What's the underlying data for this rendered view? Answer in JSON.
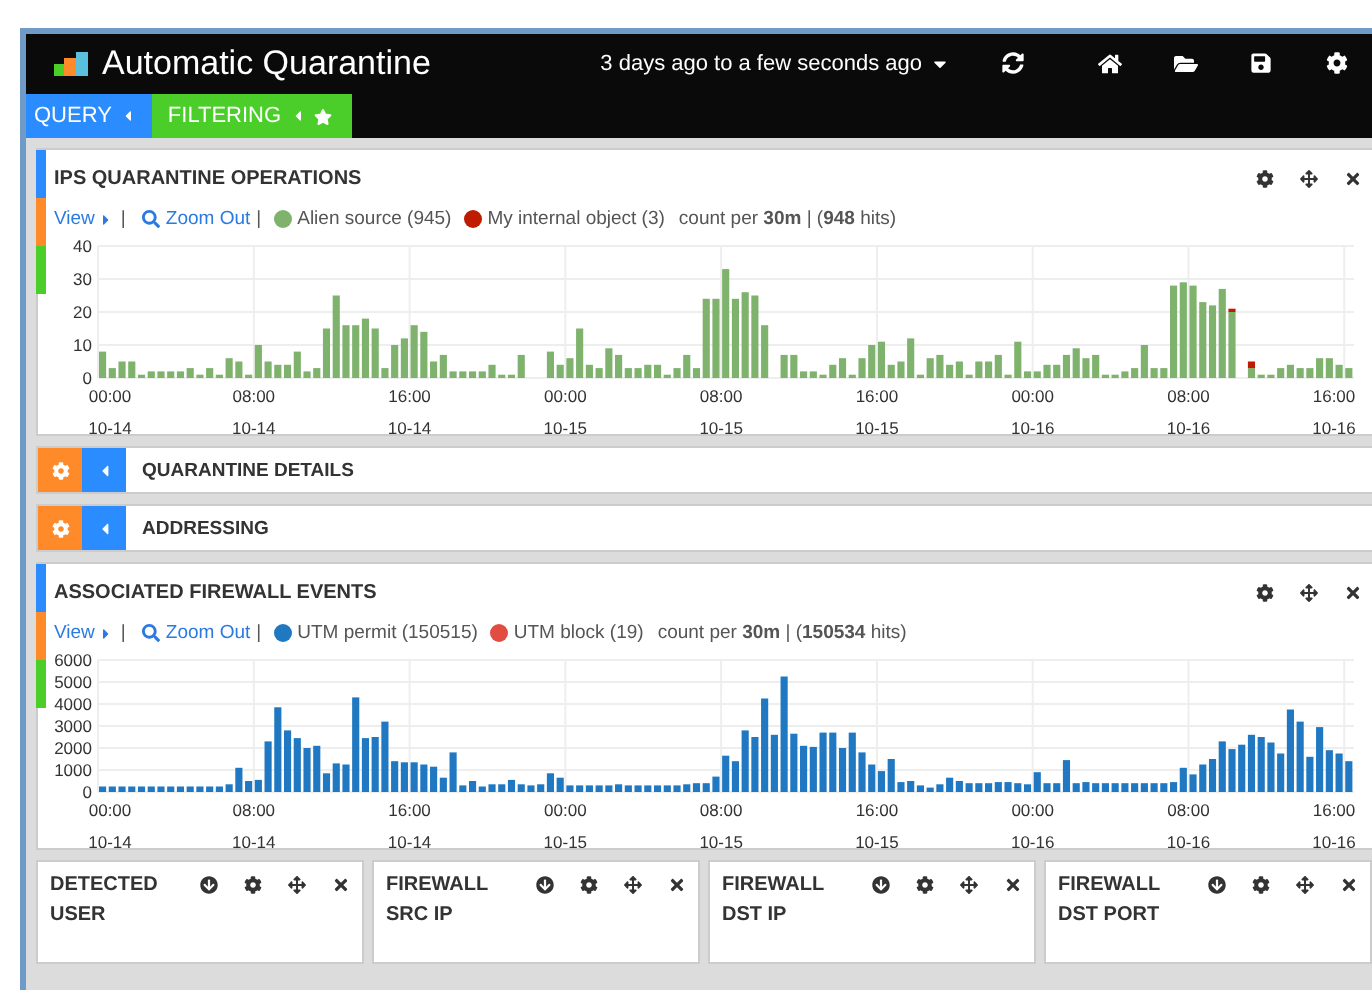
{
  "header": {
    "title": "Automatic Quarantine",
    "time_range": "3 days ago to a few seconds ago"
  },
  "tabs": [
    {
      "label": "QUERY",
      "kind": "query"
    },
    {
      "label": "FILTERING",
      "kind": "filtering"
    }
  ],
  "panels": [
    {
      "title": "IPS QUARANTINE OPERATIONS",
      "view": "View",
      "zoom": "Zoom Out",
      "legend": [
        {
          "label": "Alien source (945)",
          "color": "#7eb26d"
        },
        {
          "label": "My internal object (3)",
          "color": "#bf1b00"
        }
      ],
      "summary": "count per **30m** | (**948** hits)",
      "separator": "|",
      "x_labels": [
        {
          "time": "00:00",
          "date": "10-14"
        },
        {
          "time": "08:00",
          "date": "10-14"
        },
        {
          "time": "16:00",
          "date": "10-14"
        },
        {
          "time": "00:00",
          "date": "10-15"
        },
        {
          "time": "08:00",
          "date": "10-15"
        },
        {
          "time": "16:00",
          "date": "10-15"
        },
        {
          "time": "00:00",
          "date": "10-16"
        },
        {
          "time": "08:00",
          "date": "10-16"
        },
        {
          "time": "16:00",
          "date": "10-16"
        }
      ],
      "chart_data": {
        "type": "bar",
        "stacked": true,
        "grid": true,
        "ylim": [
          0,
          40
        ],
        "yticks": [
          0,
          10,
          20,
          30,
          40
        ],
        "series": [
          {
            "color": "#7eb26d",
            "values": [
              8,
              3,
              5,
              5,
              1,
              2,
              2,
              2,
              2,
              3,
              1,
              3,
              1,
              6,
              5,
              1,
              10,
              5,
              4,
              4,
              8,
              2,
              3,
              15,
              25,
              16,
              16,
              18,
              15,
              3,
              10,
              12,
              16,
              14,
              5,
              7,
              2,
              2,
              2,
              2,
              4,
              1,
              1,
              7,
              0,
              0,
              8,
              4,
              6,
              15,
              4,
              3,
              9,
              7,
              3,
              3,
              4,
              4,
              1,
              3,
              7,
              3,
              24,
              24,
              33,
              24,
              26,
              25,
              16,
              0,
              7,
              7,
              2,
              2,
              1,
              4,
              6,
              1,
              6,
              10,
              11,
              4,
              5,
              12,
              1,
              6,
              7,
              4,
              5,
              1,
              5,
              5,
              7,
              1,
              11,
              2,
              2,
              4,
              4,
              7,
              9,
              6,
              7,
              1,
              1,
              2,
              3,
              10,
              3,
              3,
              28,
              29,
              28,
              23,
              22,
              27,
              20,
              0,
              3,
              1,
              1,
              3,
              4,
              3,
              3,
              6,
              6,
              4,
              3
            ]
          },
          {
            "color": "#bf1b00",
            "values": [
              0,
              0,
              0,
              0,
              0,
              0,
              0,
              0,
              0,
              0,
              0,
              0,
              0,
              0,
              0,
              0,
              0,
              0,
              0,
              0,
              0,
              0,
              0,
              0,
              0,
              0,
              0,
              0,
              0,
              0,
              0,
              0,
              0,
              0,
              0,
              0,
              0,
              0,
              0,
              0,
              0,
              0,
              0,
              0,
              0,
              0,
              0,
              0,
              0,
              0,
              0,
              0,
              0,
              0,
              0,
              0,
              0,
              0,
              0,
              0,
              0,
              0,
              0,
              0,
              0,
              0,
              0,
              0,
              0,
              0,
              0,
              0,
              0,
              0,
              0,
              0,
              0,
              0,
              0,
              0,
              0,
              0,
              0,
              0,
              0,
              0,
              0,
              0,
              0,
              0,
              0,
              0,
              0,
              0,
              0,
              0,
              0,
              0,
              0,
              0,
              0,
              0,
              0,
              0,
              0,
              0,
              0,
              0,
              0,
              0,
              0,
              0,
              0,
              0,
              0,
              0,
              1,
              0,
              2,
              0,
              0,
              0,
              0,
              0,
              0,
              0,
              0,
              0,
              0
            ]
          }
        ]
      }
    },
    {
      "title": "ASSOCIATED FIREWALL EVENTS",
      "view": "View",
      "zoom": "Zoom Out",
      "legend": [
        {
          "label": "UTM permit (150515)",
          "color": "#1f78c1"
        },
        {
          "label": "UTM block (19)",
          "color": "#e24d42"
        }
      ],
      "summary": "count per **30m** | (**150534** hits)",
      "separator": "|",
      "x_labels": [
        {
          "time": "00:00",
          "date": "10-14"
        },
        {
          "time": "08:00",
          "date": "10-14"
        },
        {
          "time": "16:00",
          "date": "10-14"
        },
        {
          "time": "00:00",
          "date": "10-15"
        },
        {
          "time": "08:00",
          "date": "10-15"
        },
        {
          "time": "16:00",
          "date": "10-15"
        },
        {
          "time": "00:00",
          "date": "10-16"
        },
        {
          "time": "08:00",
          "date": "10-16"
        },
        {
          "time": "16:00",
          "date": "10-16"
        }
      ],
      "chart_data": {
        "type": "bar",
        "stacked": true,
        "grid": true,
        "ylim": [
          0,
          6000
        ],
        "yticks": [
          0,
          1000,
          2000,
          3000,
          4000,
          5000,
          6000
        ],
        "series": [
          {
            "color": "#1f78c1",
            "values": [
              250,
              250,
              250,
              250,
              250,
              250,
              250,
              250,
              250,
              250,
              250,
              250,
              250,
              350,
              1100,
              500,
              550,
              2300,
              3850,
              2800,
              2450,
              2000,
              2100,
              850,
              1300,
              1250,
              4300,
              2450,
              2500,
              3200,
              1400,
              1350,
              1350,
              1250,
              1150,
              650,
              1800,
              300,
              500,
              250,
              350,
              350,
              550,
              350,
              300,
              350,
              850,
              650,
              300,
              300,
              300,
              300,
              300,
              350,
              300,
              300,
              300,
              300,
              300,
              300,
              350,
              400,
              400,
              700,
              1650,
              1400,
              2800,
              2500,
              4250,
              2600,
              5250,
              2650,
              2100,
              2050,
              2700,
              2700,
              2000,
              2700,
              1800,
              1250,
              950,
              1500,
              450,
              500,
              300,
              200,
              350,
              650,
              500,
              400,
              400,
              400,
              450,
              450,
              400,
              350,
              900,
              400,
              400,
              1450,
              400,
              450,
              400,
              400,
              400,
              400,
              400,
              400,
              400,
              400,
              450,
              1100,
              800,
              1250,
              1500,
              2300,
              1950,
              2150,
              2600,
              2500,
              2250,
              1750,
              3750,
              3200,
              1600,
              2950,
              1900,
              1750,
              1400
            ]
          }
        ]
      }
    }
  ],
  "collapsed": [
    {
      "title": "QUARANTINE DETAILS"
    },
    {
      "title": "ADDRESSING"
    }
  ],
  "mini_panels": [
    {
      "title": "DETECTED",
      "subtitle": "USER"
    },
    {
      "title": "FIREWALL",
      "subtitle": "SRC IP"
    },
    {
      "title": "FIREWALL",
      "subtitle": "DST IP"
    },
    {
      "title": "FIREWALL",
      "subtitle": "DST PORT"
    }
  ]
}
